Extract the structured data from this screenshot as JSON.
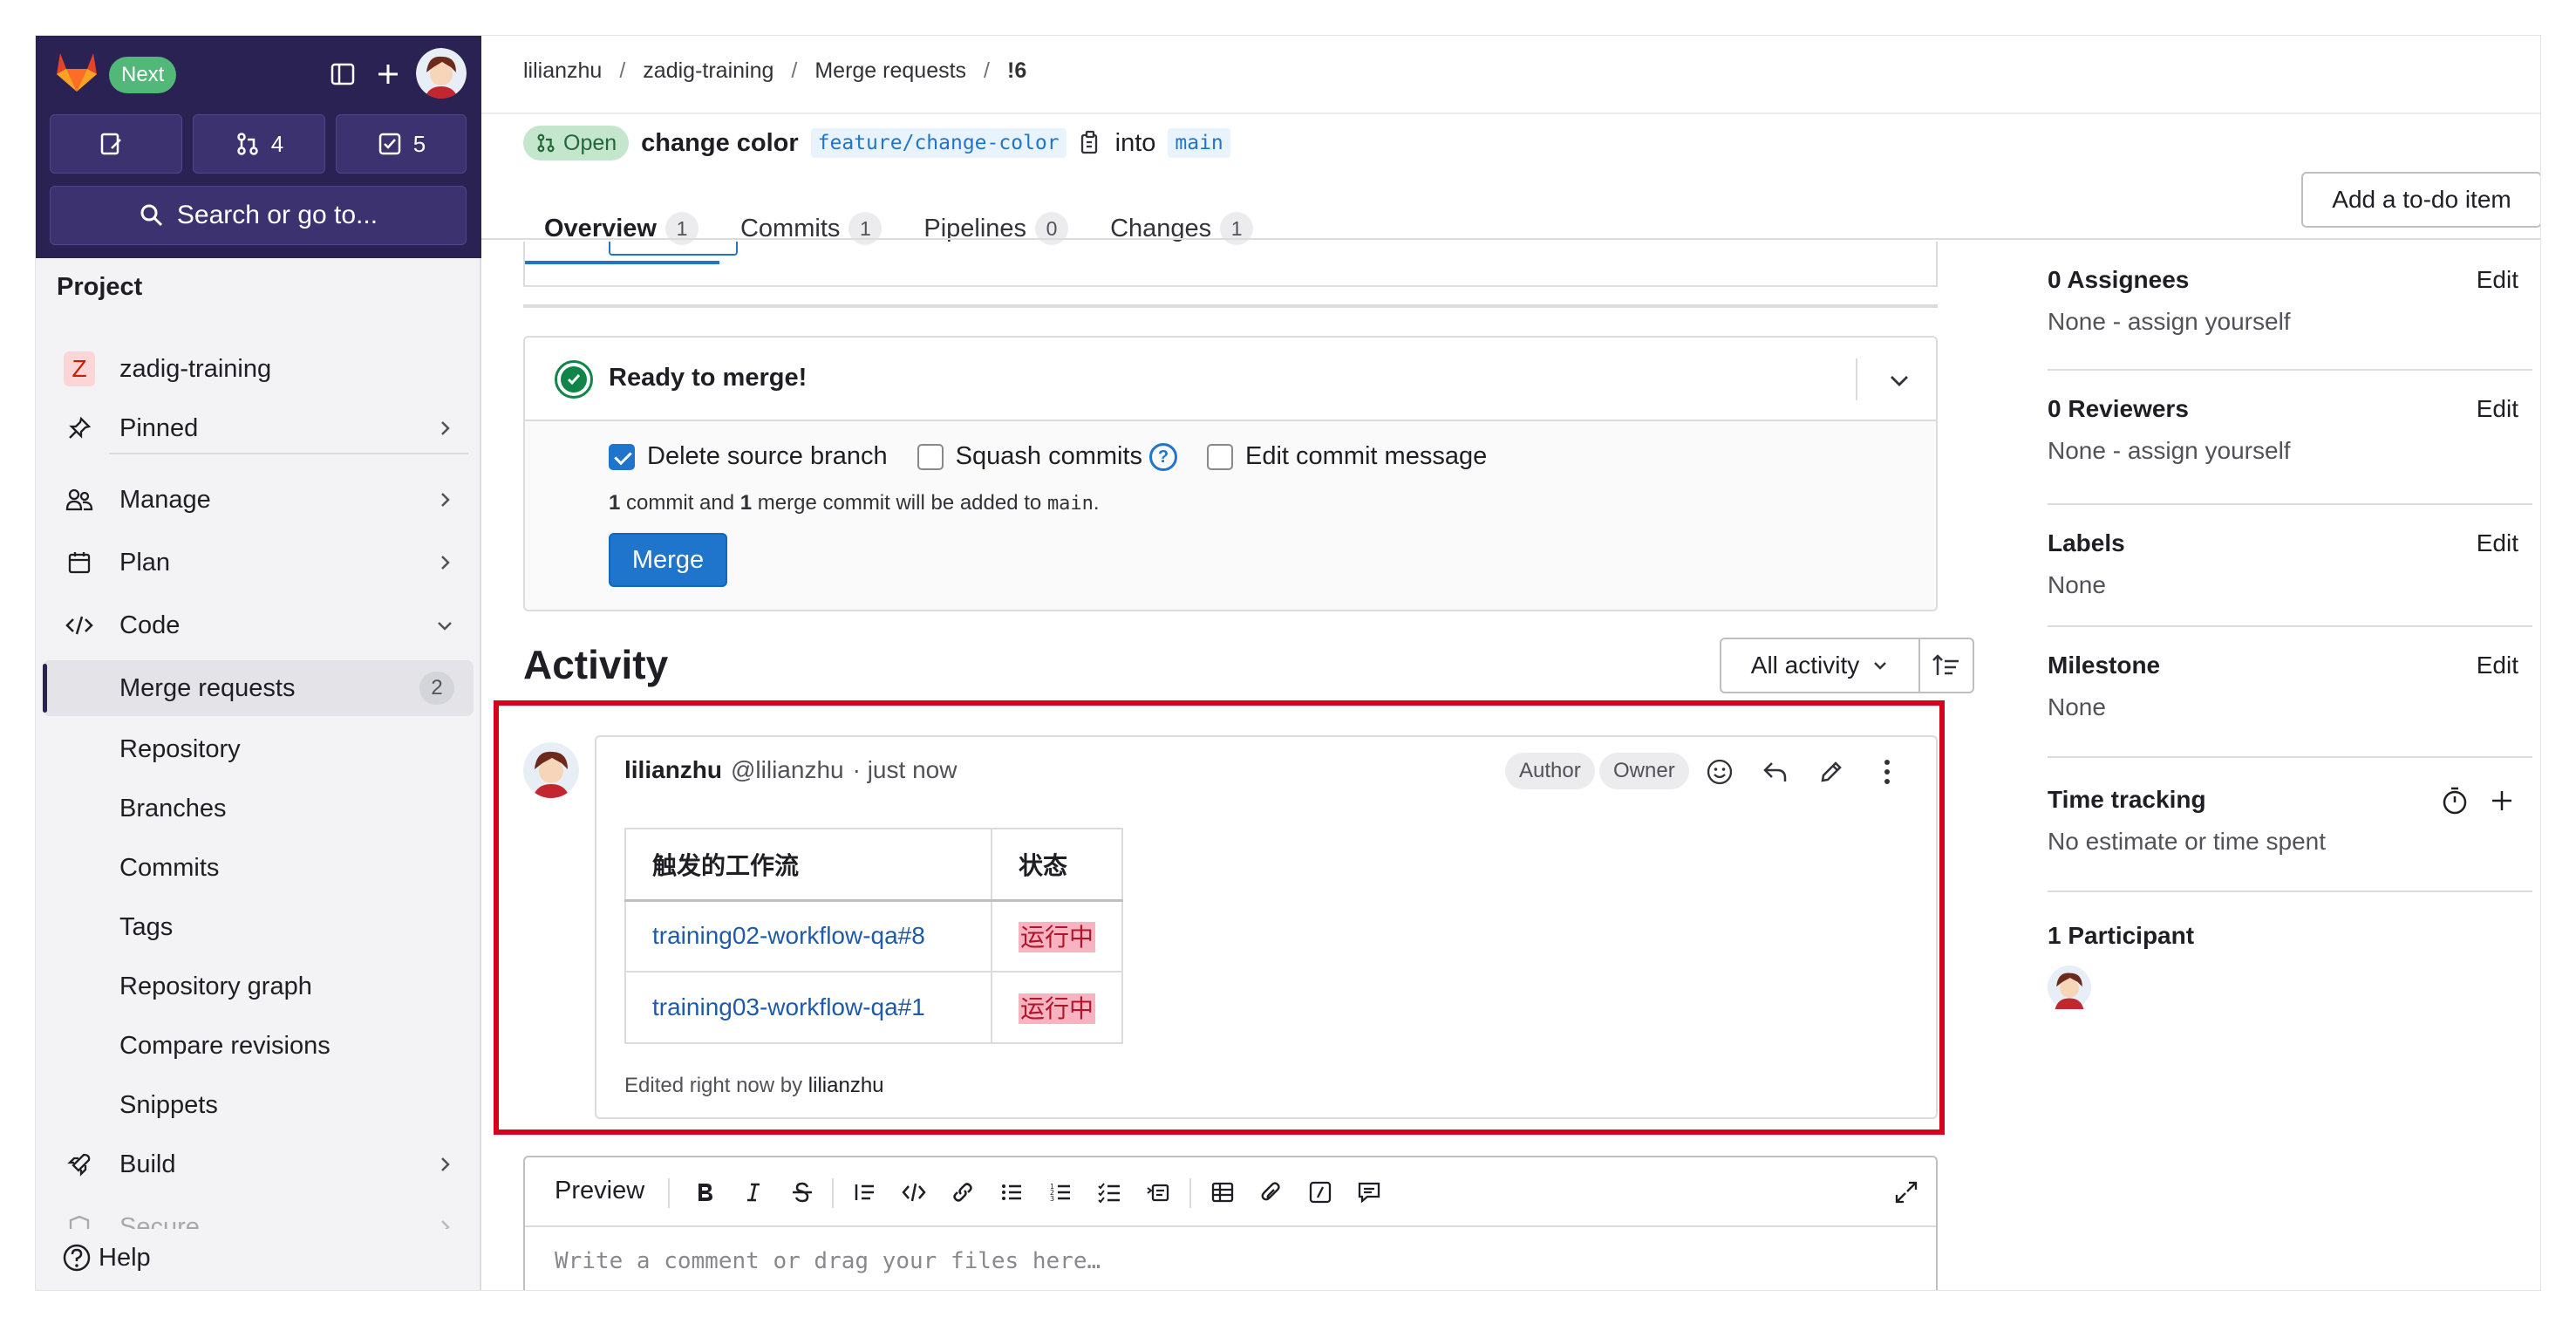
{
  "sidebar": {
    "next_badge": "Next",
    "counters": [
      {
        "icon": "issues-icon",
        "count": ""
      },
      {
        "icon": "merge-request-icon",
        "count": "4"
      },
      {
        "icon": "todo-icon",
        "count": "5"
      }
    ],
    "search_label": "Search or go to...",
    "project_heading": "Project",
    "project_initial": "Z",
    "project_name": "zadig-training",
    "items": [
      {
        "label": "Pinned",
        "icon": "pin-icon"
      },
      {
        "label": "Manage",
        "icon": "users-icon"
      },
      {
        "label": "Plan",
        "icon": "calendar-icon"
      },
      {
        "label": "Code",
        "icon": "code-icon"
      }
    ],
    "code_sub": [
      {
        "label": "Merge requests",
        "count": "2"
      },
      {
        "label": "Repository"
      },
      {
        "label": "Branches"
      },
      {
        "label": "Commits"
      },
      {
        "label": "Tags"
      },
      {
        "label": "Repository graph"
      },
      {
        "label": "Compare revisions"
      },
      {
        "label": "Snippets"
      }
    ],
    "build_label": "Build",
    "secure_label": "Secure",
    "help_label": "Help"
  },
  "breadcrumb": {
    "user": "lilianzhu",
    "project": "zadig-training",
    "section": "Merge requests",
    "current": "!6"
  },
  "mr": {
    "status": "Open",
    "title": "change color",
    "source_branch": "feature/change-color",
    "into_label": "into",
    "target_branch": "main"
  },
  "tabs": [
    {
      "label": "Overview",
      "count": "1"
    },
    {
      "label": "Commits",
      "count": "1"
    },
    {
      "label": "Pipelines",
      "count": "0"
    },
    {
      "label": "Changes",
      "count": "1"
    }
  ],
  "todo_button": "Add a to-do item",
  "merge_widget": {
    "status": "Ready to merge!",
    "delete_source_label": "Delete source branch",
    "delete_source_checked": true,
    "squash_label": "Squash commits",
    "edit_message_label": "Edit commit message",
    "note_num1": "1",
    "note_mid1": "commit and",
    "note_num2": "1",
    "note_mid2": "merge commit will be added to",
    "note_branch": "main",
    "note_end": ".",
    "merge_button": "Merge"
  },
  "activity": {
    "heading": "Activity",
    "filter_label": "All activity"
  },
  "comment": {
    "author": "lilianzhu",
    "handle": "@lilianzhu",
    "time": "· just now",
    "badges": [
      "Author",
      "Owner"
    ],
    "table_headers": [
      "触发的工作流",
      "状态"
    ],
    "rows": [
      {
        "workflow": "training02-workflow-qa#8",
        "status": "运行中"
      },
      {
        "workflow": "training03-workflow-qa#1",
        "status": "运行中"
      }
    ],
    "edited_prefix": "Edited right now by",
    "edited_by": "lilianzhu"
  },
  "editor": {
    "preview_label": "Preview",
    "placeholder": "Write a comment or drag your files here…"
  },
  "right_panel": {
    "edit_label": "Edit",
    "assignees_title": "0 Assignees",
    "assignees_value": "None - assign yourself",
    "reviewers_title": "0 Reviewers",
    "reviewers_value": "None - assign yourself",
    "labels_title": "Labels",
    "labels_value": "None",
    "milestone_title": "Milestone",
    "milestone_value": "None",
    "time_title": "Time tracking",
    "time_value": "No estimate or time spent",
    "participants_title": "1 Participant"
  },
  "colors": {
    "sidebar_top": "#2b2254",
    "accent": "#1f75cb",
    "highlight": "#d6021d",
    "open_badge": "#c3e6cd",
    "success": "#108548"
  }
}
